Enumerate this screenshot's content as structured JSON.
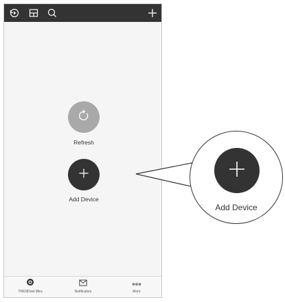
{
  "topbar": {
    "icons": [
      "history-icon",
      "layout-icon",
      "search-icon",
      "add-icon"
    ]
  },
  "main": {
    "refresh_label": "Refresh",
    "add_device_label": "Add Device"
  },
  "bottom_nav": [
    {
      "label": "TRENDnet Mira",
      "icon": "camera-icon"
    },
    {
      "label": "Notification",
      "icon": "mail-icon"
    },
    {
      "label": "More",
      "icon": "more-dots-icon"
    }
  ],
  "callout": {
    "label": "Add Device"
  },
  "colors": {
    "dark": "#333333",
    "refresh_button": "#a9a9a9",
    "background": "#f5f5f5"
  }
}
